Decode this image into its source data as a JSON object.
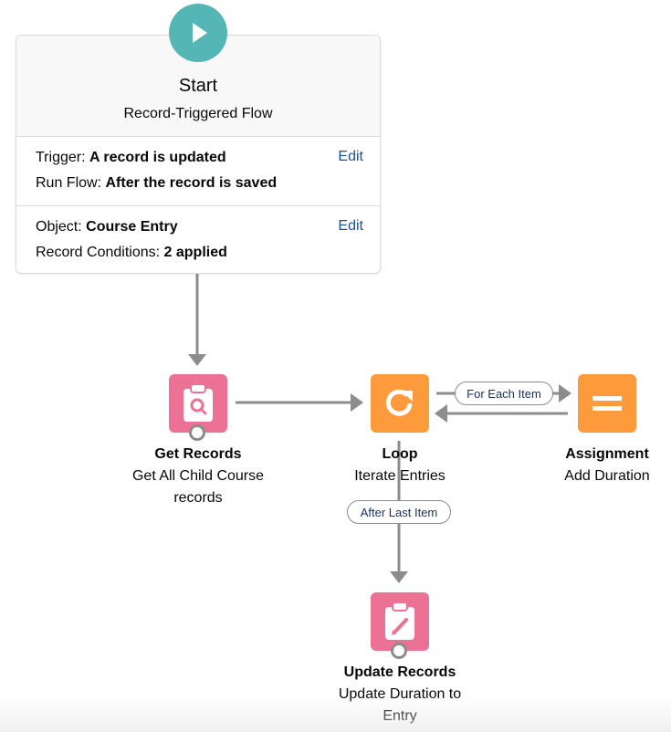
{
  "start": {
    "icon": "play-icon",
    "title": "Start",
    "subtitle": "Record-Triggered Flow",
    "trigger_label": "Trigger:",
    "trigger_value": "A record is updated",
    "run_flow_label": "Run Flow:",
    "run_flow_value": "After the record is saved",
    "object_label": "Object:",
    "object_value": "Course Entry",
    "conditions_label": "Record Conditions:",
    "conditions_value": "2 applied",
    "edit_label": "Edit"
  },
  "nodes": {
    "get_records": {
      "icon": "clipboard-search-icon",
      "type": "Get Records",
      "name_line1": "Get All Child Course",
      "name_line2": "records"
    },
    "loop": {
      "icon": "loop-icon",
      "type": "Loop",
      "name": "Iterate Entries"
    },
    "assignment": {
      "icon": "equals-icon",
      "type": "Assignment",
      "name": "Add Duration"
    },
    "update_records": {
      "icon": "clipboard-pencil-icon",
      "type": "Update Records",
      "name_line1": "Update Duration to",
      "name_line2": "Entry"
    }
  },
  "connectors": {
    "for_each_item": "For Each Item",
    "after_last_item": "After Last Item"
  },
  "colors": {
    "start": "#54b7b6",
    "data_element": "#ec7295",
    "logic_element": "#fd9a3c",
    "connector": "#8c8c8c",
    "link": "#1b5297"
  }
}
